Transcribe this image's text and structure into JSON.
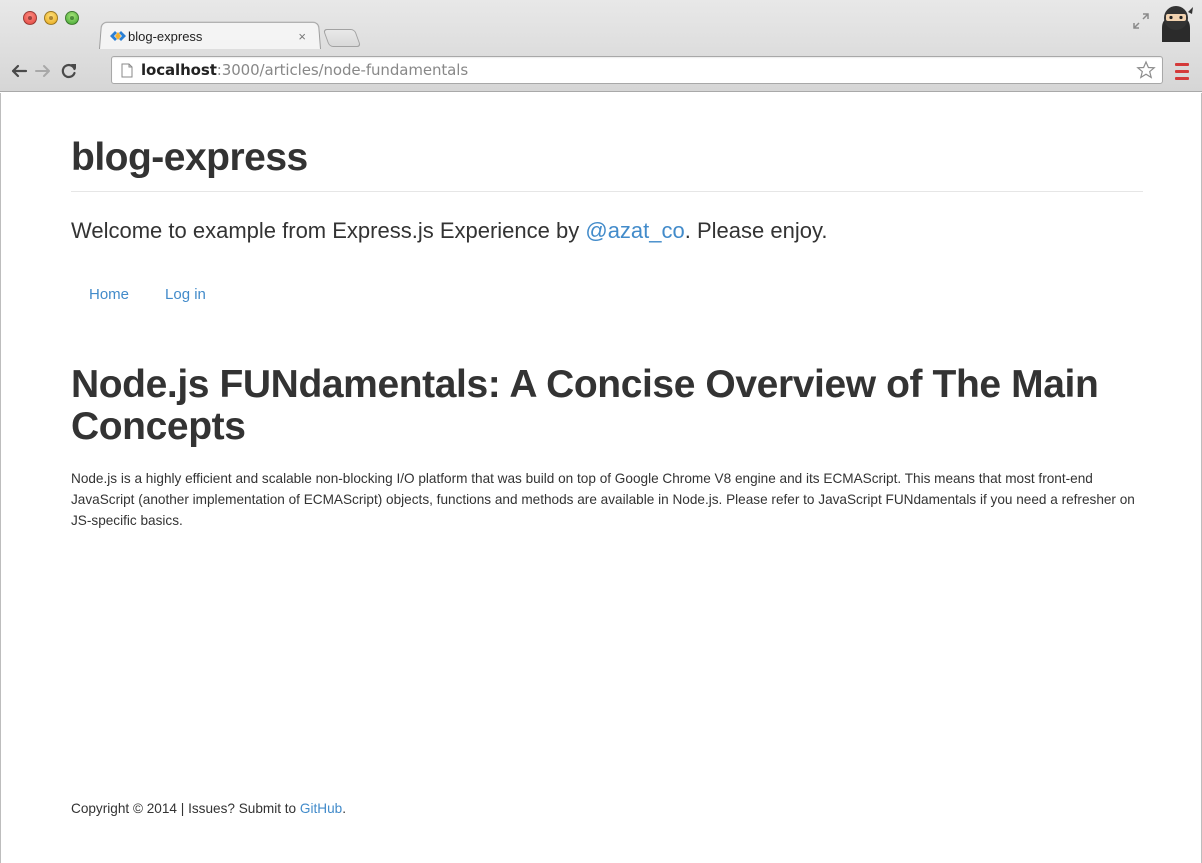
{
  "browser": {
    "tab": {
      "title": "blog-express",
      "close_glyph": "×"
    },
    "url": {
      "host": "localhost",
      "path": ":3000/articles/node-fundamentals"
    },
    "icons": {
      "back": "back-arrow-icon",
      "forward": "forward-arrow-icon",
      "reload": "reload-icon",
      "page": "page-icon",
      "bookmark": "star-icon",
      "menu": "hamburger-menu-icon",
      "profile": "ninja-avatar-icon",
      "fullscreen": "fullscreen-icon"
    }
  },
  "site": {
    "title": "blog-express",
    "lead_prefix": "Welcome to example from Express.js Experience by ",
    "lead_link": "@azat_co",
    "lead_suffix": ". Please enjoy."
  },
  "nav": {
    "items": [
      {
        "label": "Home"
      },
      {
        "label": "Log in"
      }
    ]
  },
  "article": {
    "title": "Node.js FUNdamentals: A Concise Overview of The Main Concepts",
    "text": "Node.js is a highly efficient and scalable non-blocking I/O platform that was build on top of Google Chrome V8 engine and its ECMAScript. This means that most front-end JavaScript (another implementation of ECMAScript) objects, functions and methods are available in Node.js. Please refer to JavaScript FUNdamentals if you need a refresher on JS-specific basics."
  },
  "footer": {
    "prefix": "Copyright © 2014 | Issues? Submit to ",
    "link": "GitHub",
    "suffix": "."
  },
  "colors": {
    "link": "#428bca",
    "text": "#333333",
    "menu_accent": "#d43a3a"
  }
}
